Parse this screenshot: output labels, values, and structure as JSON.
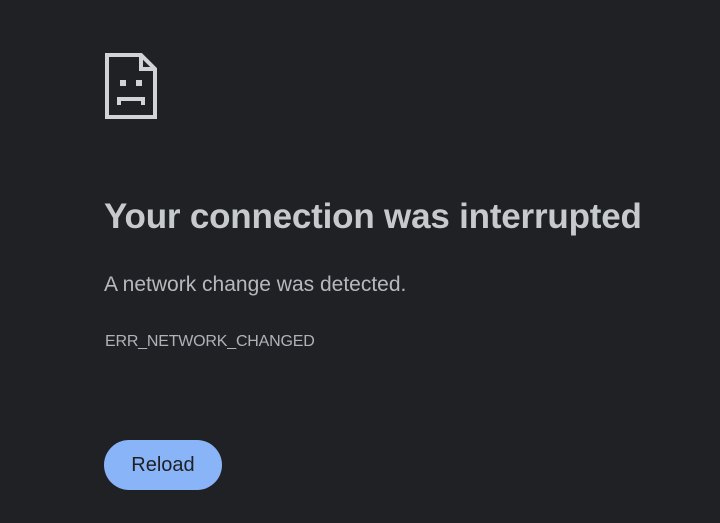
{
  "error_icon": {
    "name": "sad-document-icon",
    "color": "#d1d4d7"
  },
  "heading": "Your connection was interrupted",
  "message": "A network change was detected.",
  "error_code": "ERR_NETWORK_CHANGED",
  "actions": {
    "reload_label": "Reload"
  },
  "colors": {
    "background": "#202124",
    "heading": "#c7cacd",
    "text": "#b5b9be",
    "button_background": "#8ab4f8",
    "button_text": "#202124"
  }
}
